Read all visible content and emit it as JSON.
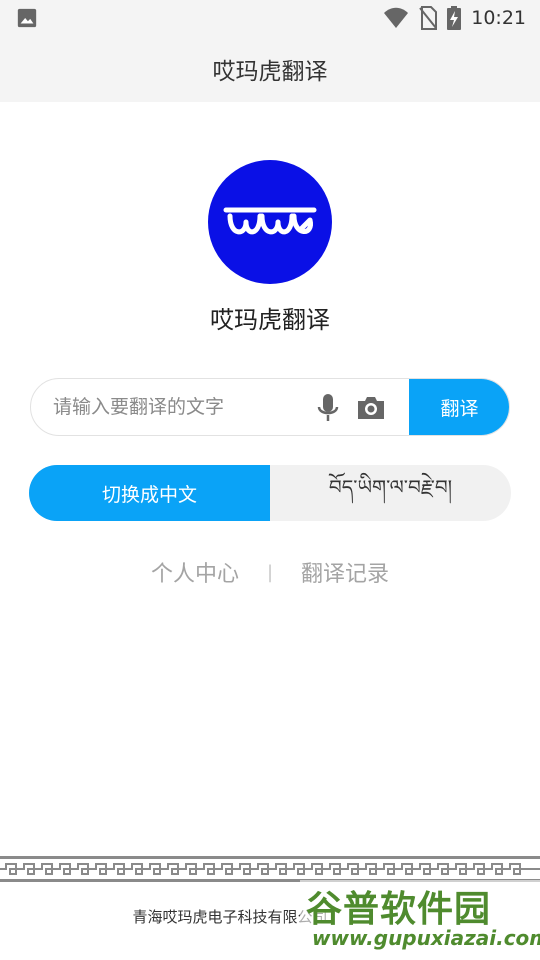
{
  "status_bar": {
    "time": "10:21",
    "icons": [
      "image-notification-icon",
      "wifi-icon",
      "no-sim-icon",
      "battery-charging-icon"
    ]
  },
  "app_bar": {
    "title": "哎玛虎翻译"
  },
  "logo": {
    "name": "哎玛虎翻译"
  },
  "search": {
    "placeholder": "请输入要翻译的文字",
    "value": "",
    "button_label": "翻译"
  },
  "language_toggle": {
    "chinese_label": "切换成中文",
    "tibetan_label": "བོད་ཡིག་ལ་བརྗེ་བ།"
  },
  "links": {
    "personal_center": "个人中心",
    "separator": "|",
    "history": "翻译记录"
  },
  "footer": {
    "company": "青海哎玛虎电子科技有限公司"
  },
  "watermark": {
    "title": "谷普软件园",
    "url": "www.gupuxiazai.com"
  },
  "colors": {
    "accent": "#0aa3f7",
    "logo_bg": "#0a10e6",
    "bar_bg": "#f4f4f4"
  }
}
